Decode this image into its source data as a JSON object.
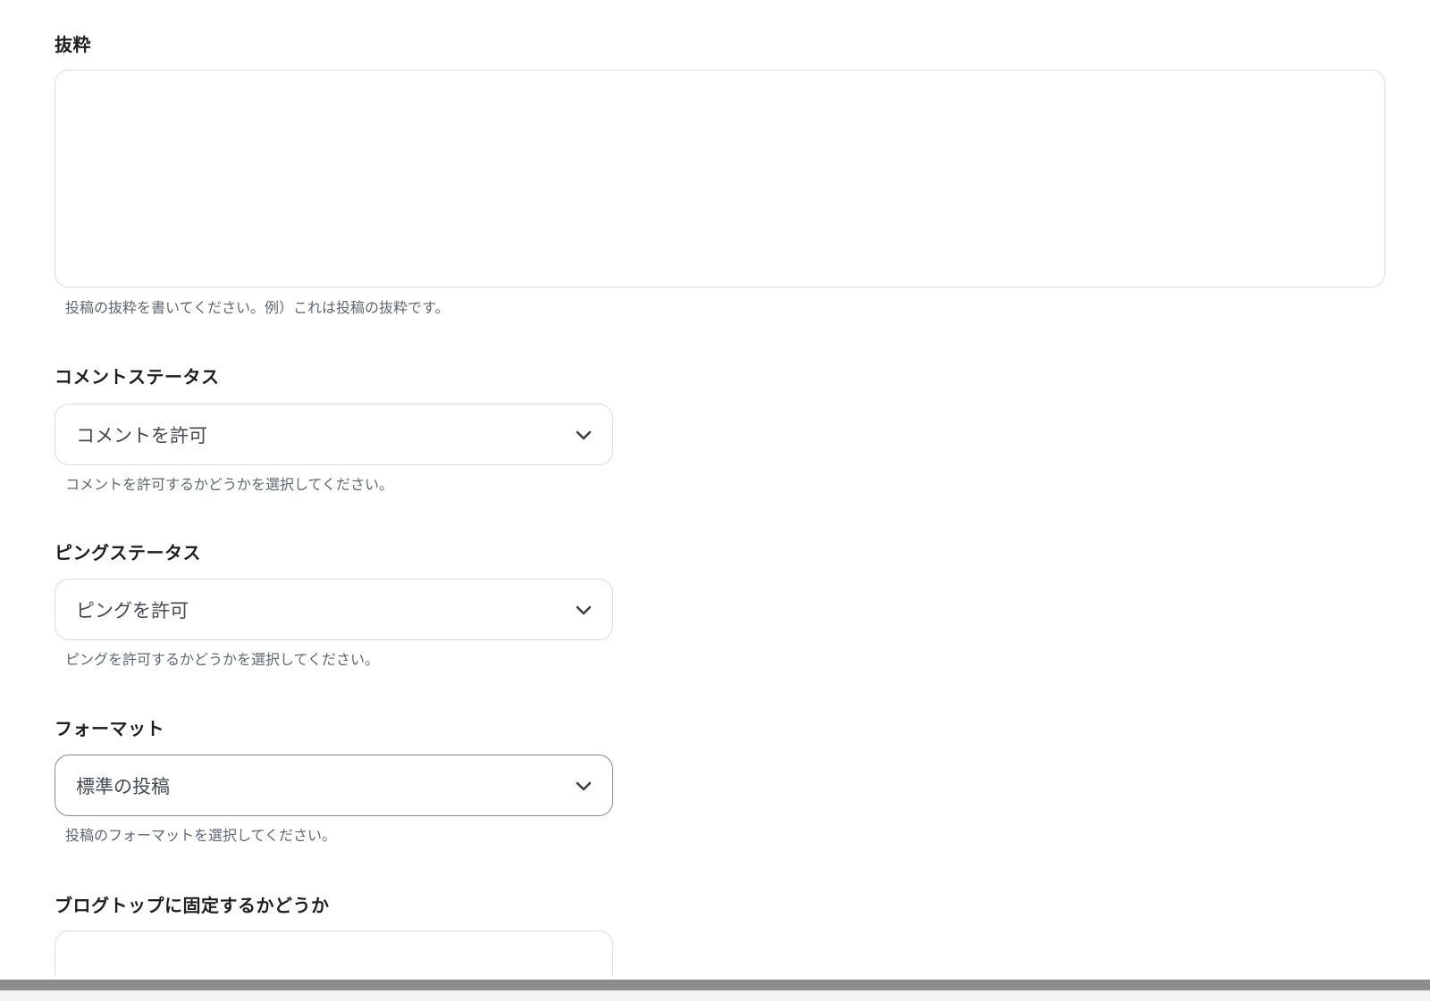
{
  "excerpt": {
    "label": "抜粋",
    "value": "",
    "help": "投稿の抜粋を書いてください。例）これは投稿の抜粋です。"
  },
  "comment_status": {
    "label": "コメントステータス",
    "selected": "コメントを許可",
    "help": "コメントを許可するかどうかを選択してください。"
  },
  "ping_status": {
    "label": "ピングステータス",
    "selected": "ピングを許可",
    "help": "ピングを許可するかどうかを選択してください。"
  },
  "format": {
    "label": "フォーマット",
    "selected": "標準の投稿",
    "help": "投稿のフォーマットを選択してください。"
  },
  "sticky": {
    "label": "ブログトップに固定するかどうか"
  },
  "icons": {
    "dropdown": "chevron-down-icon"
  },
  "colors": {
    "label_text": "#1f1f1f",
    "help_text": "#5f6770",
    "field_border": "#dcdcdc",
    "focused_border": "#8a8a8a",
    "scrollbar": "#8c8c8c"
  }
}
